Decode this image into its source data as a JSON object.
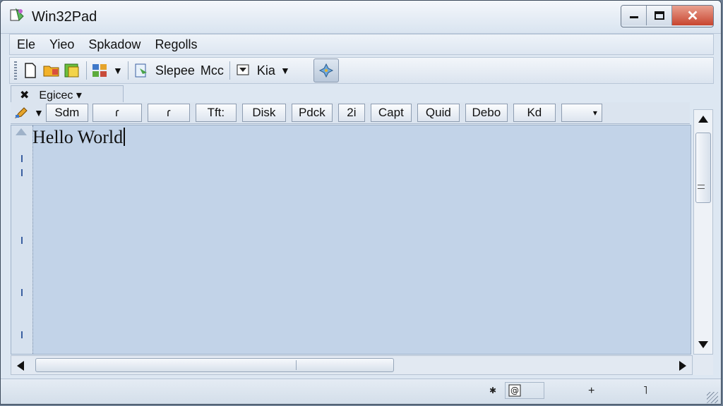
{
  "window": {
    "title": "Win32Pad"
  },
  "menu": {
    "items": [
      {
        "label": "Ele"
      },
      {
        "label": "Yieo"
      },
      {
        "label": "Spkadow"
      },
      {
        "label": "Regolls"
      }
    ]
  },
  "toolbar": {
    "label_1": "Slepee",
    "label_2": "Mcc",
    "label_3": "Kia",
    "dropdown_glyph": "▼"
  },
  "tab": {
    "label": "Egicec",
    "close_glyph": "✖",
    "dropdown_glyph": "▾"
  },
  "button_row": {
    "first_label": "Sdm",
    "buttons": [
      "ɾ",
      "ɾ",
      "Tft:",
      "Disk",
      "Pdck",
      "2i",
      "Capt",
      "Quid",
      "Debo",
      "Kd"
    ]
  },
  "editor": {
    "text": "Hello World"
  },
  "statusbar": {
    "plus_glyph": "+",
    "mark_glyph": "˥"
  },
  "colors": {
    "editor_bg": "#c2d3e8",
    "close_button": "#c8452f"
  }
}
